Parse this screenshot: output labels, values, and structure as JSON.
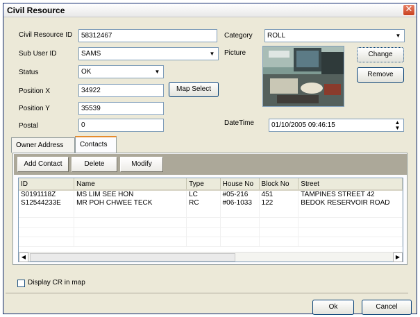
{
  "window": {
    "title": "Civil Resource",
    "close_glyph": "✕"
  },
  "form": {
    "cr_id_label": "Civil Resource ID",
    "cr_id_value": "58312467",
    "sub_user_label": "Sub User ID",
    "sub_user_value": "SAMS",
    "status_label": "Status",
    "status_value": "OK",
    "pos_x_label": "Position X",
    "pos_x_value": "34922",
    "pos_y_label": "Position Y",
    "pos_y_value": "35539",
    "postal_label": "Postal",
    "postal_value": "0",
    "map_select_label": "Map Select",
    "category_label": "Category",
    "category_value": "ROLL",
    "picture_label": "Picture",
    "change_label": "Change",
    "remove_label": "Remove",
    "datetime_label": "DateTime",
    "datetime_value": "01/10/2005 09:46:15"
  },
  "tabs": [
    {
      "label": "Owner Address"
    },
    {
      "label": "Contacts"
    }
  ],
  "contacts_toolbar": {
    "add_label": "Add Contact",
    "delete_label": "Delete",
    "modify_label": "Modify"
  },
  "grid": {
    "columns": [
      "ID",
      "Name",
      "Type",
      "House No",
      "Block No",
      "Street"
    ],
    "rows": [
      [
        "S0191118Z",
        "MS LIM SEE HON",
        "LC",
        "#05-216",
        "451",
        "TAMPINES STREET 42"
      ],
      [
        "S12544233E",
        "MR POH CHWEE TECK",
        "RC",
        "#06-1033",
        "122",
        "BEDOK RESERVOIR ROAD"
      ]
    ]
  },
  "display_cr_label": "Display CR in map",
  "footer": {
    "ok_label": "Ok",
    "cancel_label": "Cancel"
  },
  "icons": {
    "dropdown": "chevron-down-icon",
    "spin": "spin-icon",
    "scroll_left": "arrow-left-icon",
    "scroll_right": "arrow-right-icon"
  },
  "colors": {
    "title_text": "#000000",
    "close_button": "#c8401e",
    "tab_highlight": "#e68b2c",
    "toolbar_bg": "#aca899"
  }
}
